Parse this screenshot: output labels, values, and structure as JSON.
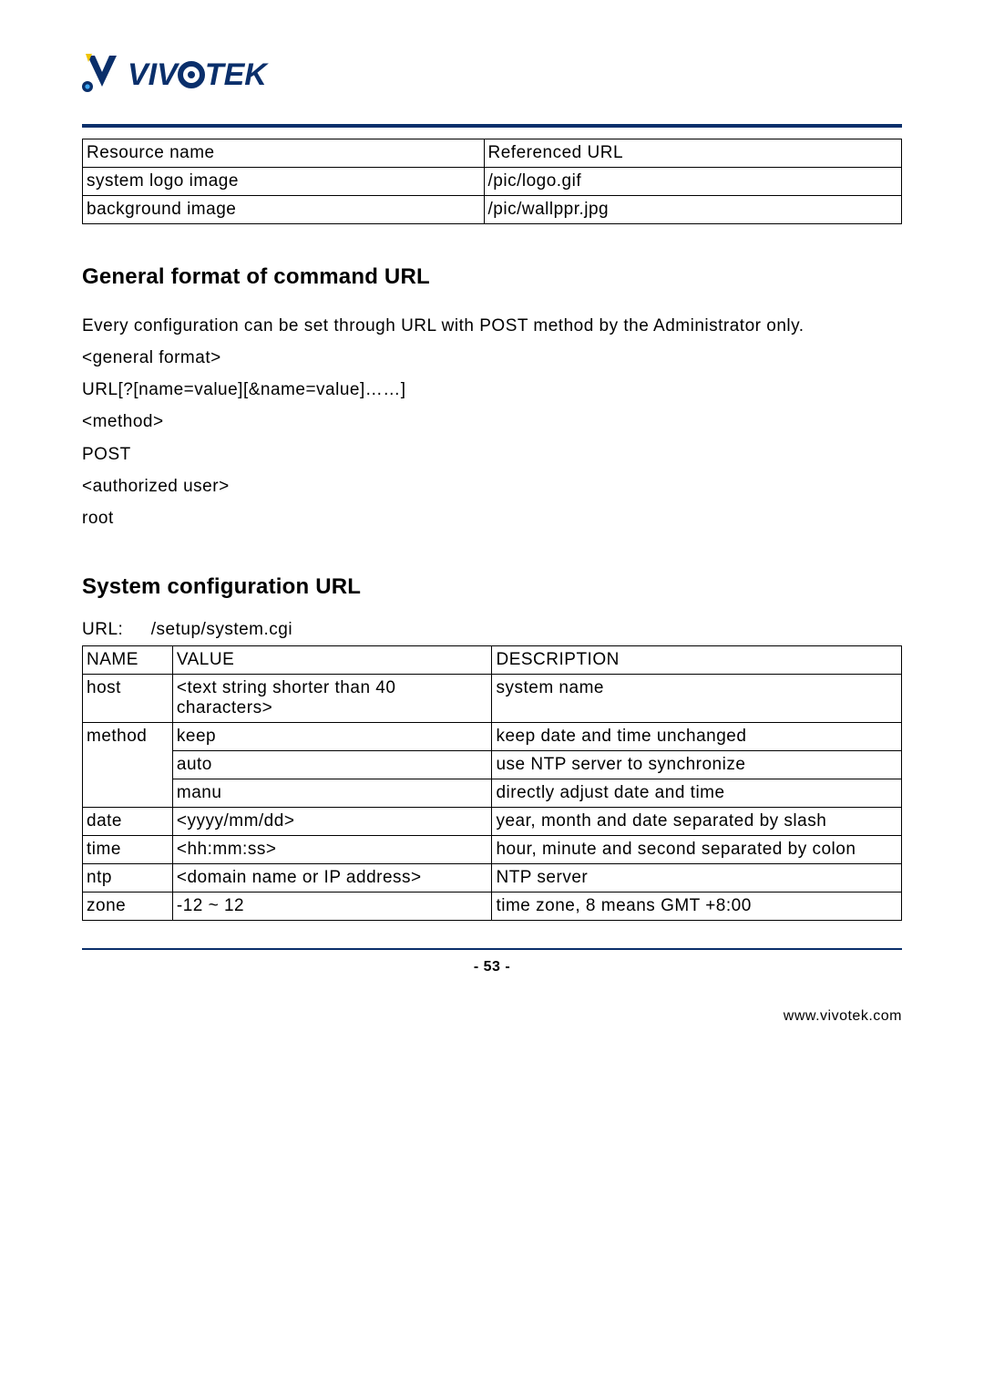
{
  "brand": {
    "wordmark_part1": "VIV",
    "wordmark_part2": "TEK"
  },
  "resource_table": {
    "headers": [
      "Resource name",
      "Referenced URL"
    ],
    "rows": [
      [
        "system logo image",
        "/pic/logo.gif"
      ],
      [
        "background image",
        "/pic/wallppr.jpg"
      ]
    ]
  },
  "section1": {
    "heading": "General format of command URL",
    "intro": "Every configuration can be set through URL with POST method by the Administrator only.",
    "block": [
      "<general format>",
      "URL[?[name=value][&name=value]……]",
      "<method>",
      "POST",
      "<authorized user>",
      "root"
    ]
  },
  "section2": {
    "heading": "System configuration URL",
    "url_label": "URL:",
    "url_value": "/setup/system.cgi",
    "table": {
      "headers": [
        "NAME",
        "VALUE",
        "DESCRIPTION"
      ],
      "rows": [
        {
          "name": "host",
          "value": "<text string shorter than 40 characters>",
          "desc": "system name"
        },
        {
          "name": "method",
          "subrows": [
            {
              "value": "keep",
              "desc": "keep date and time unchanged"
            },
            {
              "value": "auto",
              "desc": "use NTP server to synchronize"
            },
            {
              "value": "manu",
              "desc": "directly adjust date and time"
            }
          ]
        },
        {
          "name": "date",
          "value": "<yyyy/mm/dd>",
          "desc": "year, month and date separated by slash"
        },
        {
          "name": "time",
          "value": "<hh:mm:ss>",
          "desc": "hour, minute and second separated by colon"
        },
        {
          "name": "ntp",
          "value": "<domain name or IP address>",
          "desc": "NTP server"
        },
        {
          "name": "zone",
          "value": "-12 ~ 12",
          "desc": "time zone, 8 means GMT +8:00"
        }
      ]
    }
  },
  "page_number": "- 53 -",
  "footer_url": "www.vivotek.com"
}
